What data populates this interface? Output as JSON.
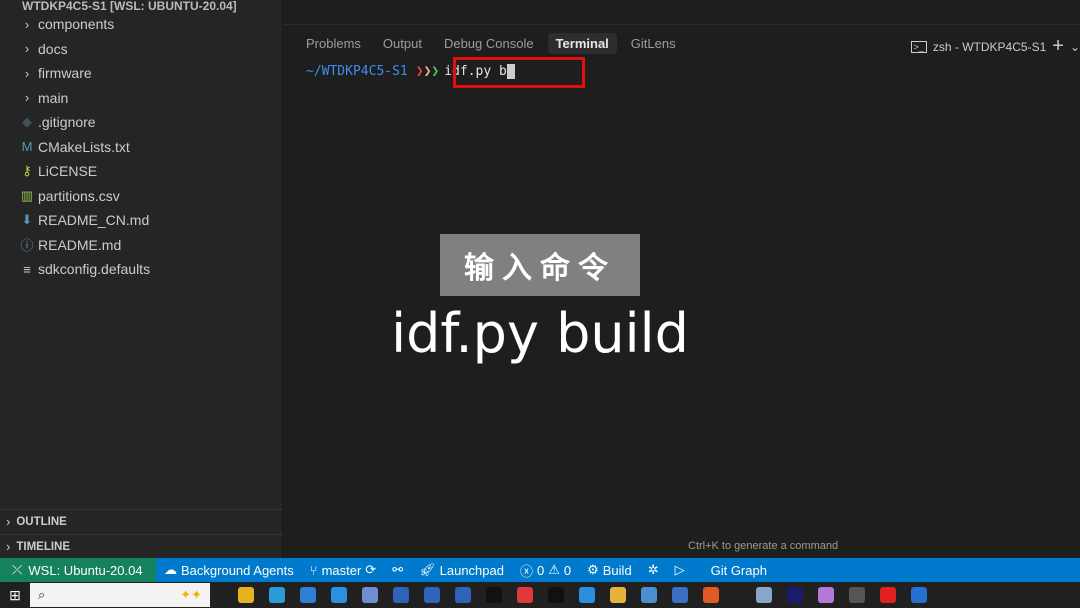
{
  "explorer": {
    "title": "WTDKP4C5-S1 [WSL: UBUNTU-20.04]",
    "items": [
      {
        "label": "components",
        "icon": "chevron-right-icon",
        "glyph": "›",
        "color": "#ccc"
      },
      {
        "label": "docs",
        "icon": "chevron-right-icon",
        "glyph": "›",
        "color": "#ccc"
      },
      {
        "label": "firmware",
        "icon": "chevron-right-icon",
        "glyph": "›",
        "color": "#ccc"
      },
      {
        "label": "main",
        "icon": "chevron-right-icon",
        "glyph": "›",
        "color": "#ccc"
      },
      {
        "label": ".gitignore",
        "icon": "git-file-icon",
        "glyph": "◆",
        "color": "#41535b"
      },
      {
        "label": "CMakeLists.txt",
        "icon": "cmake-file-icon",
        "glyph": "M",
        "color": "#519aba"
      },
      {
        "label": "LiCENSE",
        "icon": "license-file-icon",
        "glyph": "⚷",
        "color": "#cbcb41"
      },
      {
        "label": "partitions.csv",
        "icon": "csv-file-icon",
        "glyph": "▥",
        "color": "#8dc149"
      },
      {
        "label": "README_CN.md",
        "icon": "markdown-file-icon",
        "glyph": "⬇",
        "color": "#519aba"
      },
      {
        "label": "README.md",
        "icon": "info-file-icon",
        "glyph": "ⓘ",
        "color": "#519aba"
      },
      {
        "label": "sdkconfig.defaults",
        "icon": "settings-file-icon",
        "glyph": "≡",
        "color": "#ccc"
      }
    ]
  },
  "sections": {
    "outline": "OUTLINE",
    "timeline": "TIMELINE"
  },
  "panel": {
    "tabs": [
      "Problems",
      "Output",
      "Debug Console",
      "Terminal",
      "GitLens"
    ],
    "active": "Terminal",
    "terminal_name": "zsh - WTDKP4C5-S1",
    "add": "+",
    "dropdown": "⌄"
  },
  "terminal": {
    "path": "~/WTDKP4C5-S1",
    "arrows": "❯❯❯",
    "command": "idf.py b"
  },
  "overlay": {
    "label": "输入命令",
    "caption": "idf.py build"
  },
  "hint": "Ctrl+K to generate a command",
  "status": {
    "remote": "WSL: Ubuntu-20.04",
    "agents": "Background Agents",
    "branch": "master",
    "launchpad": "Launchpad",
    "errors": "0",
    "warnings": "0",
    "build": "Build",
    "git_graph": "Git Graph"
  },
  "colors": {
    "status_bg": "#007acc",
    "remote_bg": "#16825d",
    "highlight": "#e01010"
  },
  "taskbar": {
    "icons": [
      {
        "name": "chrome-icon",
        "color": "#e8b21e"
      },
      {
        "name": "edge-icon",
        "color": "#2b9ad8"
      },
      {
        "name": "search-app-icon",
        "color": "#2f7fd6"
      },
      {
        "name": "settings-icon",
        "color": "#2b90e0"
      },
      {
        "name": "building-app-icon",
        "color": "#6d8fd0"
      },
      {
        "name": "app-s1-icon",
        "color": "#2e63b8"
      },
      {
        "name": "app-s2-icon",
        "color": "#2e63b8"
      },
      {
        "name": "app-s3-icon",
        "color": "#2e63b8"
      },
      {
        "name": "terminal-icon",
        "color": "#111"
      },
      {
        "name": "xmind-icon",
        "color": "#e0383b"
      },
      {
        "name": "app-box-icon",
        "color": "#111"
      },
      {
        "name": "vscode-icon",
        "color": "#2b8fe0"
      },
      {
        "name": "file-explorer-icon",
        "color": "#e6b33a"
      },
      {
        "name": "v-app-icon",
        "color": "#4a90d0"
      },
      {
        "name": "powershell-icon",
        "color": "#3a6fc4"
      },
      {
        "name": "ubuntu-icon",
        "color": "#e05a27"
      },
      {
        "name": "app-wave-icon",
        "color": "#8aa6c8"
      },
      {
        "name": "premiere-icon",
        "color": "#1b1b6e"
      },
      {
        "name": "cat-app-icon",
        "color": "#b57ad8"
      },
      {
        "name": "github-icon",
        "color": "#555"
      },
      {
        "name": "record-icon",
        "color": "#e02020"
      },
      {
        "name": "app-blue-icon",
        "color": "#2570d0"
      }
    ]
  }
}
